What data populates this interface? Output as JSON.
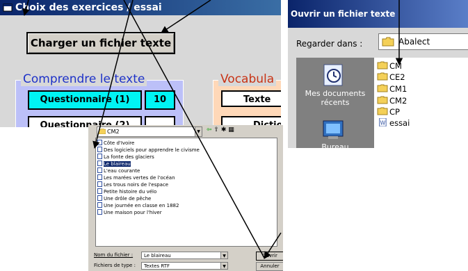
{
  "win1": {
    "title": "Choix des exercices / essai",
    "load_button": "Charger un fichier texte",
    "section1_title": "Comprendre le texte",
    "q1_label": "Questionnaire (1)",
    "q1_count": "10",
    "q2_label": "Questionnaire (2)",
    "section2_title": "Vocabula",
    "texte_label": "Texte",
    "dict_label": "Dictio"
  },
  "win2": {
    "title": "Ouvrir un fichier texte",
    "look_in_label": "Regarder dans :",
    "look_in_value": "Abalect",
    "places": [
      "Mes documents récents",
      "Bureau"
    ],
    "items": [
      "CM",
      "CE2",
      "CM1",
      "CM2",
      "CP",
      "essai"
    ]
  },
  "win3": {
    "look_in_value": "CM2",
    "items": [
      "Côte d'Ivoire",
      "Des logiciels pour apprendre le civisme",
      "La fonte des glaciers",
      "Le blaireau",
      "L'eau courante",
      "Les marées vertes de l'océan",
      "Les trous noirs de l'espace",
      "Petite histoire du vélo",
      "Une drôle de pêche",
      "Une journée en classe en 1882",
      "Une maison pour l'hiver"
    ],
    "selected_index": 3,
    "filename_label": "Nom du fichier :",
    "filename_value": "Le blaireau",
    "filetype_label": "Fichiers de type :",
    "filetype_value": "Textes RTF",
    "open_button": "Ouvrir",
    "cancel_button": "Annuler"
  },
  "colors": {
    "titlebar": "#0a246a",
    "section1_bg": "#bcc0f8",
    "section1_title": "#1e32c8",
    "section2_title": "#c83214",
    "cyan_button": "#00f4f4",
    "folder_yellow": "#f4d058"
  }
}
